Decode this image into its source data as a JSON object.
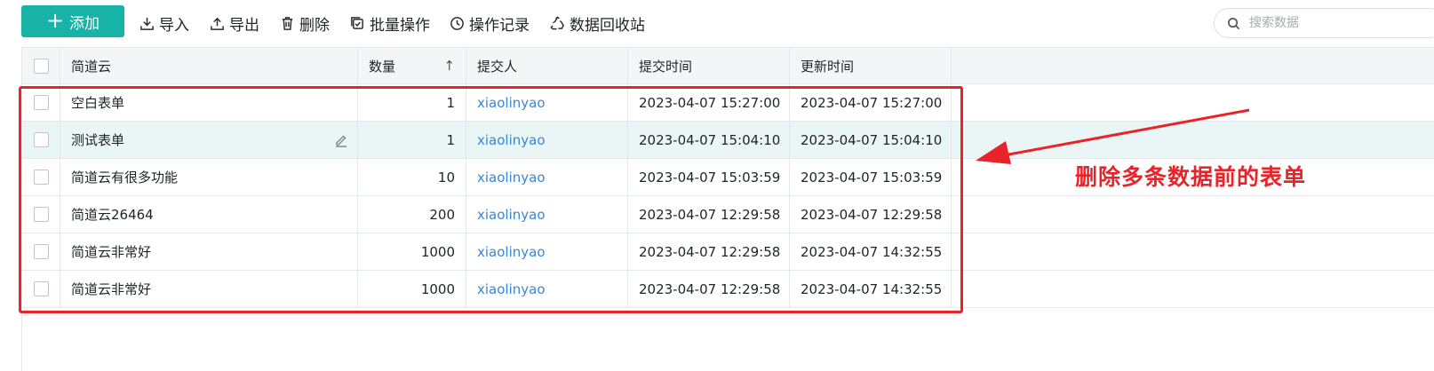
{
  "toolbar": {
    "add_label": "添加",
    "import_label": "导入",
    "export_label": "导出",
    "delete_label": "删除",
    "batch_label": "批量操作",
    "log_label": "操作记录",
    "recycle_label": "数据回收站"
  },
  "search": {
    "placeholder": "搜索数据"
  },
  "table": {
    "headers": {
      "name": "简道云",
      "quantity": "数量",
      "submitter": "提交人",
      "submit_time": "提交时间",
      "update_time": "更新时间"
    },
    "rows": [
      {
        "name": "空白表单",
        "quantity": "1",
        "submitter": "xiaolinyao",
        "submit_time": "2023-04-07 15:27:00",
        "update_time": "2023-04-07 15:27:00"
      },
      {
        "name": "测试表单",
        "quantity": "1",
        "submitter": "xiaolinyao",
        "submit_time": "2023-04-07 15:04:10",
        "update_time": "2023-04-07 15:04:10"
      },
      {
        "name": "简道云有很多功能",
        "quantity": "10",
        "submitter": "xiaolinyao",
        "submit_time": "2023-04-07 15:03:59",
        "update_time": "2023-04-07 15:03:59"
      },
      {
        "name": "简道云26464",
        "quantity": "200",
        "submitter": "xiaolinyao",
        "submit_time": "2023-04-07 12:29:58",
        "update_time": "2023-04-07 12:29:58"
      },
      {
        "name": "简道云非常好",
        "quantity": "1000",
        "submitter": "xiaolinyao",
        "submit_time": "2023-04-07 12:29:58",
        "update_time": "2023-04-07 14:32:55"
      },
      {
        "name": "简道云非常好",
        "quantity": "1000",
        "submitter": "xiaolinyao",
        "submit_time": "2023-04-07 12:29:58",
        "update_time": "2023-04-07 14:32:55"
      }
    ]
  },
  "annotation": {
    "text": "删除多条数据前的表单"
  },
  "colors": {
    "accent": "#16b3a6",
    "link": "#3a86d6",
    "annotation": "#e8232a",
    "hover_row": "#eaf6f5"
  },
  "icons": [
    "plus-icon",
    "import-icon",
    "export-icon",
    "trash-icon",
    "batch-icon",
    "clock-icon",
    "recycle-icon",
    "search-icon",
    "edit-icon",
    "sort-up-icon"
  ]
}
